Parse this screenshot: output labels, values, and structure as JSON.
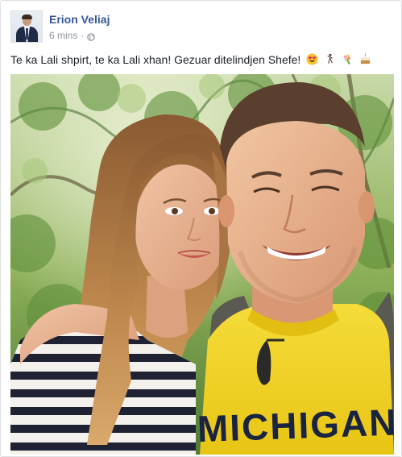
{
  "post": {
    "author_name": "Erion Veliaj",
    "timestamp": "6 mins",
    "separator": "·",
    "audience_icon": "globe-icon",
    "caption_text": "Te ka Lali shpirt, te ka Lali xhan! Gezuar ditelindjen Shefe!",
    "caption_emoji": [
      "heart-eyes-emoji",
      "dancer-emoji",
      "bouquet-emoji",
      "birthday-cake-emoji"
    ],
    "photo": {
      "shirt_print": "MICHIGAN"
    }
  },
  "colors": {
    "link_blue": "#365899",
    "meta_gray": "#90949c",
    "text_dark": "#1d2129",
    "border": "#dddfe2",
    "shirt_yellow": "#f2d21a"
  }
}
